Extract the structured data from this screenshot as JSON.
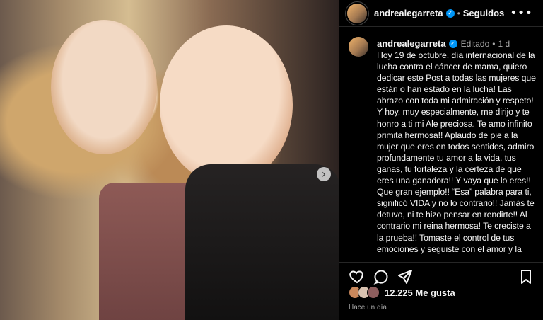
{
  "header": {
    "username": "andrealegarreta",
    "separator": "•",
    "follow_state": "Seguidos",
    "more_glyph": "•••"
  },
  "caption": {
    "username": "andrealegarreta",
    "edited": "Editado",
    "separator": "•",
    "time": "1 d",
    "text": "Hoy 19 de octubre, día internacional de la lucha contra el cáncer de mama, quiero dedicar este Post a todas las mujeres que están o han estado en la lucha! Las abrazo con toda mi admiración y respeto! Y hoy, muy especialmente, me dirijo y te honro a ti mi Ale preciosa. Te amo infinito primita hermosa!! Aplaudo de pie a la mujer que eres en todos sentidos, admiro profundamente tu amor a la vida, tus ganas, tu fortaleza y la certeza de que eres una ganadora!! Y vaya que lo eres!! Que gran ejemplo!! “Esa” palabra para ti, significó VIDA y no lo contrario!! Jamás te detuvo, ni te hizo pensar en rendirte!! Al contrario mi reina hermosa! Te creciste a la prueba!! Tomaste el control de tus emociones y seguiste con el amor y la certeza de que tienes un largo camino por"
  },
  "media": {
    "next_glyph": "›"
  },
  "actions": {
    "like_icon": "heart-icon",
    "comment_icon": "comment-icon",
    "share_icon": "share-icon",
    "save_icon": "bookmark-icon"
  },
  "likes": {
    "text": "12.225 Me gusta",
    "avatar_colors": [
      "#c9875b",
      "#d8c2b0",
      "#8d5d5d"
    ]
  },
  "time_ago": "Hace un día",
  "verified_glyph": "✓"
}
